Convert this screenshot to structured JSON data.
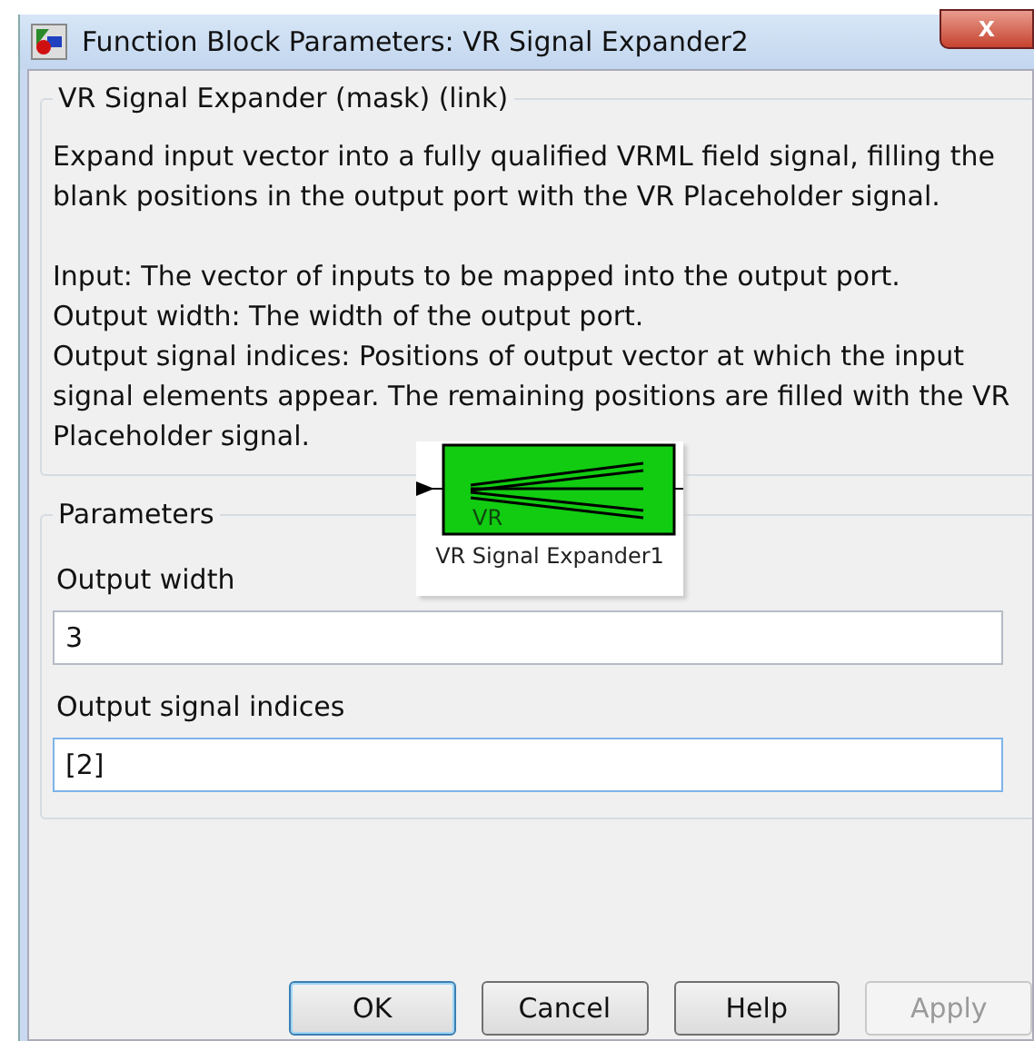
{
  "window": {
    "title": "Function Block Parameters: VR Signal Expander2",
    "close": "x"
  },
  "description_group": {
    "title": "VR Signal Expander (mask) (link)",
    "paragraphs": [
      "Expand input vector into a fully qualified VRML field signal, filling the blank positions in the output port with the VR Placeholder signal.",
      "Input: The vector of inputs to be mapped into the output port.\nOutput width: The width of the output port.\nOutput signal indices: Positions of output vector at which the input signal elements appear. The remaining positions are filled with the VR Placeholder signal."
    ]
  },
  "block_overlay": {
    "icon_text": "VR",
    "name": "VR Signal Expander1"
  },
  "parameters_group": {
    "title": "Parameters",
    "fields": [
      {
        "label": "Output width",
        "value": "3"
      },
      {
        "label": "Output signal indices",
        "value": "[2]"
      }
    ]
  },
  "buttons": [
    {
      "label": "OK",
      "default": true,
      "disabled": false
    },
    {
      "label": "Cancel",
      "default": false,
      "disabled": false
    },
    {
      "label": "Help",
      "default": false,
      "disabled": false
    },
    {
      "label": "Apply",
      "default": false,
      "disabled": true
    }
  ]
}
